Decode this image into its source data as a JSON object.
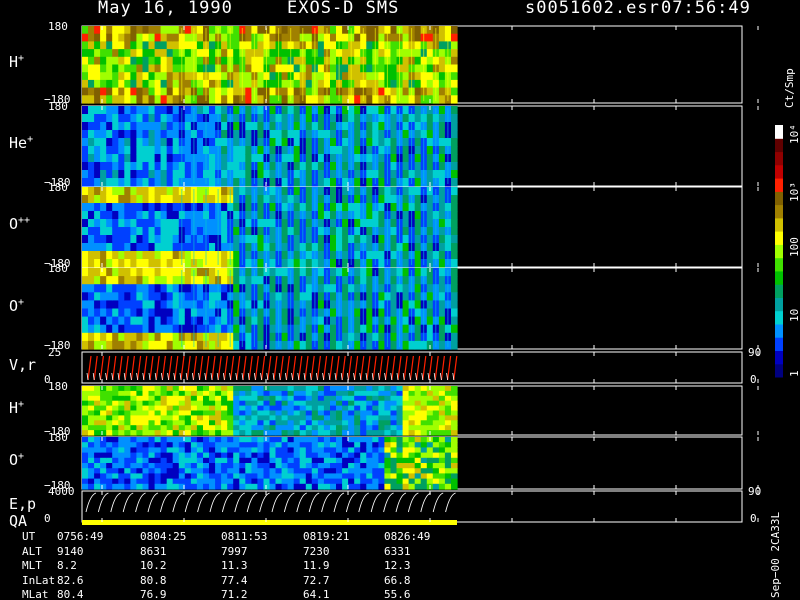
{
  "header": {
    "date": "May 16, 1990",
    "instrument": "EXOS-D SMS",
    "file": "s0051602.esr",
    "time": "07:56:49"
  },
  "colorbar": {
    "unit": "Ct/Smp",
    "ticks": [
      "1",
      "10",
      "100",
      "10³",
      "10⁴"
    ],
    "colors": [
      "#000080",
      "#0000c0",
      "#0040ff",
      "#0090ff",
      "#00d0d0",
      "#00a0a0",
      "#00a060",
      "#00c000",
      "#40e000",
      "#a0ff00",
      "#ffff00",
      "#d0c000",
      "#a08000",
      "#806000",
      "#ff2000",
      "#c00000",
      "#900000",
      "#600000",
      "#ffffff"
    ]
  },
  "panels": [
    {
      "label": "H",
      "sup": "+",
      "top": "180",
      "bot": "−180"
    },
    {
      "label": "He",
      "sup": "+",
      "top": "180",
      "bot": "−180"
    },
    {
      "label": "O",
      "sup": "++",
      "top": "180",
      "bot": "−180"
    },
    {
      "label": "O",
      "sup": "+",
      "top": "180",
      "bot": "−180"
    },
    {
      "label": "V,r",
      "sup": "",
      "top": "25",
      "bot": "0",
      "rtop": "90",
      "rbot": "0"
    },
    {
      "label": "H",
      "sup": "+",
      "top": "180",
      "bot": "−180"
    },
    {
      "label": "O",
      "sup": "+",
      "top": "180",
      "bot": "−180"
    },
    {
      "label": "E,p",
      "sup": "",
      "label2": "QA",
      "top": "4000",
      "bot": "0",
      "rtop": "90",
      "rbot": "0"
    }
  ],
  "ephemeris": {
    "rows": [
      {
        "name": "UT",
        "values": [
          "0756:49",
          "0804:25",
          "0811:53",
          "0819:21",
          "0826:49"
        ]
      },
      {
        "name": "ALT",
        "values": [
          "9140",
          "8631",
          "7997",
          "7230",
          "6331"
        ]
      },
      {
        "name": "MLT",
        "values": [
          "8.2",
          "10.2",
          "11.3",
          "11.9",
          "12.3"
        ]
      },
      {
        "name": "InLat",
        "values": [
          "82.6",
          "80.8",
          "77.4",
          "72.7",
          "66.8"
        ]
      },
      {
        "name": "MLat",
        "values": [
          "80.4",
          "76.9",
          "71.2",
          "64.1",
          "55.6"
        ]
      }
    ]
  },
  "footer_tag": "Sep−00 2CA33L",
  "chart_data": {
    "type": "heatmap",
    "title": "May 16, 1990 EXOS-D SMS",
    "x_ticks": [
      "0756:49",
      "0804:25",
      "0811:53",
      "0819:21",
      "0826:49"
    ],
    "panels": [
      "H+",
      "He+",
      "O++",
      "O+",
      "V,r",
      "H+",
      "O+",
      "E,p QA"
    ],
    "color_scale": "log",
    "color_ticks": [
      "1",
      "10",
      "100",
      "10³",
      "10⁴"
    ],
    "color_label": "Ct/Smp"
  }
}
